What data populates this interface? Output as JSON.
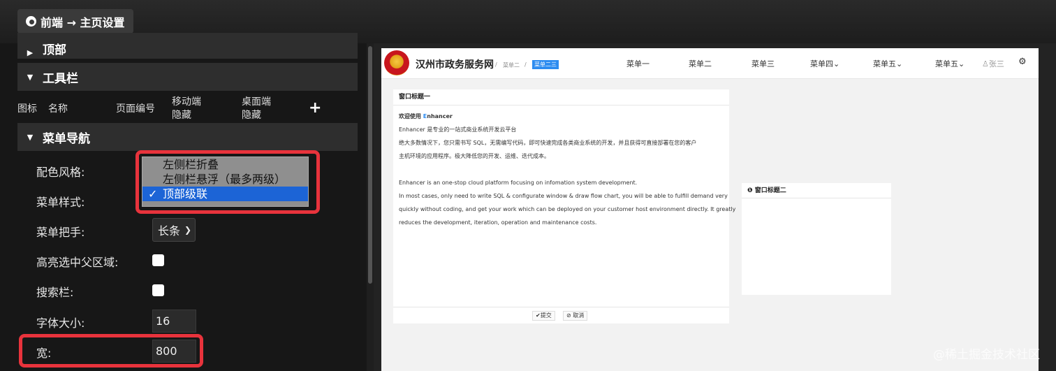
{
  "topbar": {
    "breadcrumb": "前端 → 主页设置",
    "icon": "chrome-icon"
  },
  "left": {
    "section_top": "顶部",
    "section_toolbar": "工具栏",
    "columns": {
      "icon": "图标",
      "name": "名称",
      "page_no": "页面编号",
      "mobile_hide": "移动端\n隐藏",
      "desktop_hide": "桌面端\n隐藏",
      "add": "+"
    },
    "section_menu_nav": "菜单导航",
    "fields": {
      "color_style_label": "配色风格:",
      "menu_style_label": "菜单样式:",
      "menu_handle_label": "菜单把手:",
      "menu_handle_value": "长条",
      "highlight_parent_label": "高亮选中父区域:",
      "search_bar_label": "搜索栏:",
      "font_size_label": "字体大小:",
      "font_size_value": "16",
      "width_label": "宽:",
      "width_value": "800"
    },
    "dropdown": {
      "options": [
        "左侧栏折叠",
        "左侧栏悬浮（最多两级）",
        "顶部级联"
      ],
      "selected": "顶部级联",
      "check": "✓"
    }
  },
  "preview": {
    "site_title": "汉州市政务服务网",
    "breadcrumb": [
      "菜单二",
      "菜单二三"
    ],
    "menu": [
      "菜单一",
      "菜单二",
      "菜单三",
      "菜单四",
      "菜单五",
      "菜单五"
    ],
    "user": "张三",
    "window1": {
      "title": "窗口标题一",
      "lines": [
        "欢迎使用 Enhancer",
        "Enhancer 是专业的一站式商业系统开发云平台",
        "绝大多数情况下，您只需书写 SQL，无需编写代码，即可快速完成各类商业系统的开发，并且获得可直接部署在您的客户",
        "主机环境的应用程序。极大降低您的开发、运维、迭代成本。",
        "",
        "Enhancer is an one-stop cloud platform focusing on infomation system development.",
        "In most cases, only need to write SQL & configurate window & draw flow chart, you will be able to fulfill demand very",
        "quickly without coding, and get your work which can be deployed on your customer host environment directly. It greatly",
        "reduces the development, iteration, operation and maintenance costs."
      ],
      "submit": "✔提交",
      "cancel": "⊘ 取消"
    },
    "window2": {
      "title": "窗口标题二"
    }
  },
  "watermark": "@稀土掘金技术社区",
  "colors": {
    "accent_red": "#e8333c",
    "select_blue": "#1c64d6",
    "preview_blue": "#2d8cf0"
  }
}
